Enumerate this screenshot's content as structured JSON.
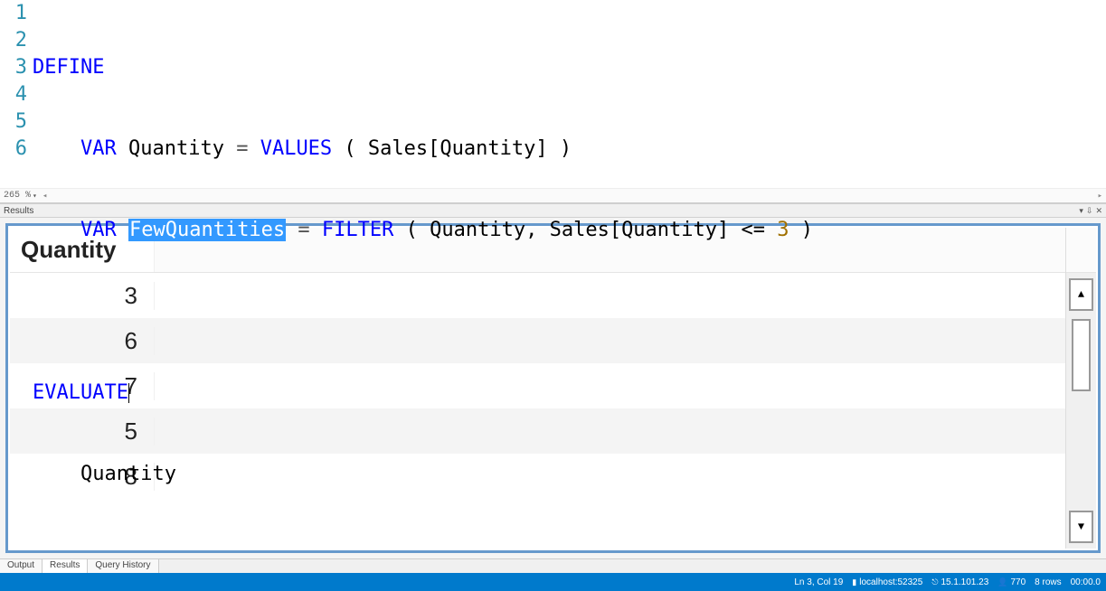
{
  "editor": {
    "zoom": "265 %",
    "lines": [
      "1",
      "2",
      "3",
      "4",
      "5",
      "6"
    ],
    "code": {
      "l1_define": "DEFINE",
      "l2_var": "VAR",
      "l2_ident": "Quantity",
      "l2_eq": " = ",
      "l2_func": "VALUES",
      "l2_rest": " ( Sales[Quantity] )",
      "l3_var": "VAR",
      "l3_sel": "FewQuantities",
      "l3_eq": " = ",
      "l3_func": "FILTER",
      "l3_mid": " ( Quantity, Sales[Quantity] <= ",
      "l3_num": "3",
      "l3_end": " )",
      "l5_eval": "EVALUATE",
      "l6_ident": "Quantity"
    }
  },
  "results_panel": {
    "title": "Results",
    "column_header": "Quantity",
    "rows": [
      "3",
      "6",
      "7",
      "5",
      "8"
    ]
  },
  "tabs": {
    "output": "Output",
    "results": "Results",
    "query_history": "Query History"
  },
  "status": {
    "position": "Ln 3, Col 19",
    "server": "localhost:52325",
    "version": "15.1.101.23",
    "user": "770",
    "rows": "8 rows",
    "time": "00:00.0"
  }
}
